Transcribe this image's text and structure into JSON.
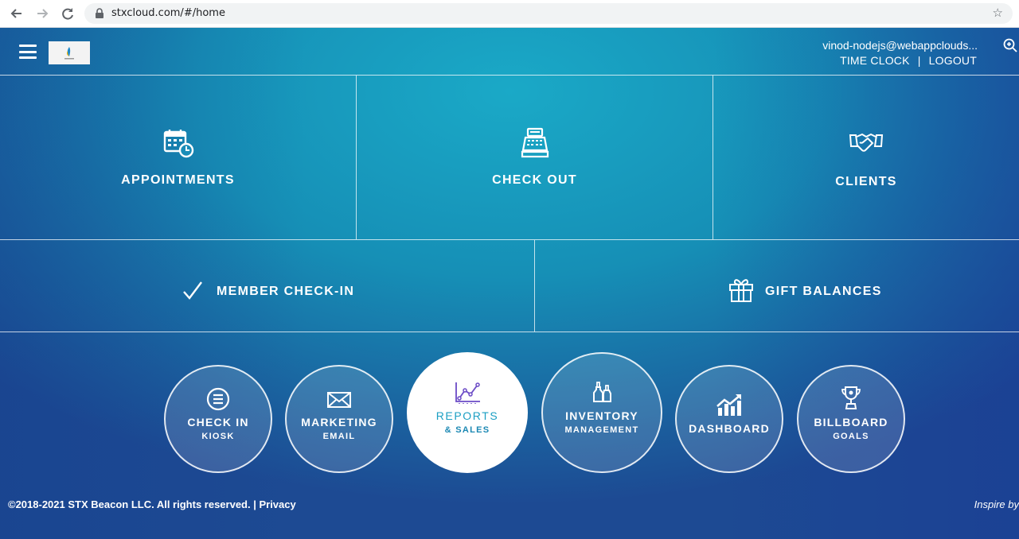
{
  "browser": {
    "url": "stxcloud.com/#/home",
    "icons": [
      "back-arrow-icon",
      "forward-arrow-icon",
      "reload-icon",
      "lock-icon",
      "star-icon"
    ]
  },
  "header": {
    "user_email": "vinod-nodejs@webappclouds...",
    "time_clock": "TIME CLOCK",
    "separator": "|",
    "logout": "LOGOUT"
  },
  "tiles": {
    "appointments": "APPOINTMENTS",
    "checkout": "CHECK OUT",
    "clients": "CLIENTS",
    "member_checkin": "MEMBER CHECK-IN",
    "gift_balances": "GIFT BALANCES"
  },
  "circles": {
    "checkin": {
      "main": "CHECK IN",
      "sub": "KIOSK"
    },
    "marketing": {
      "main": "MARKETING",
      "sub": "EMAIL"
    },
    "reports": {
      "main": "REPORTS",
      "sub": "& SALES"
    },
    "inventory": {
      "main": "INVENTORY",
      "sub": "MANAGEMENT"
    },
    "dashboard": {
      "main": "DASHBOARD"
    },
    "billboard": {
      "main": "BILLBOARD",
      "sub": "GOALS"
    }
  },
  "footer": {
    "copyright": "©2018-2021 STX Beacon LLC. All rights reserved. | Privacy",
    "tagline": "Inspire by"
  },
  "colors": {
    "accent": "#1aa9c7",
    "deep_blue": "#1d4a93",
    "active_circle_text": "#1b88b3"
  }
}
